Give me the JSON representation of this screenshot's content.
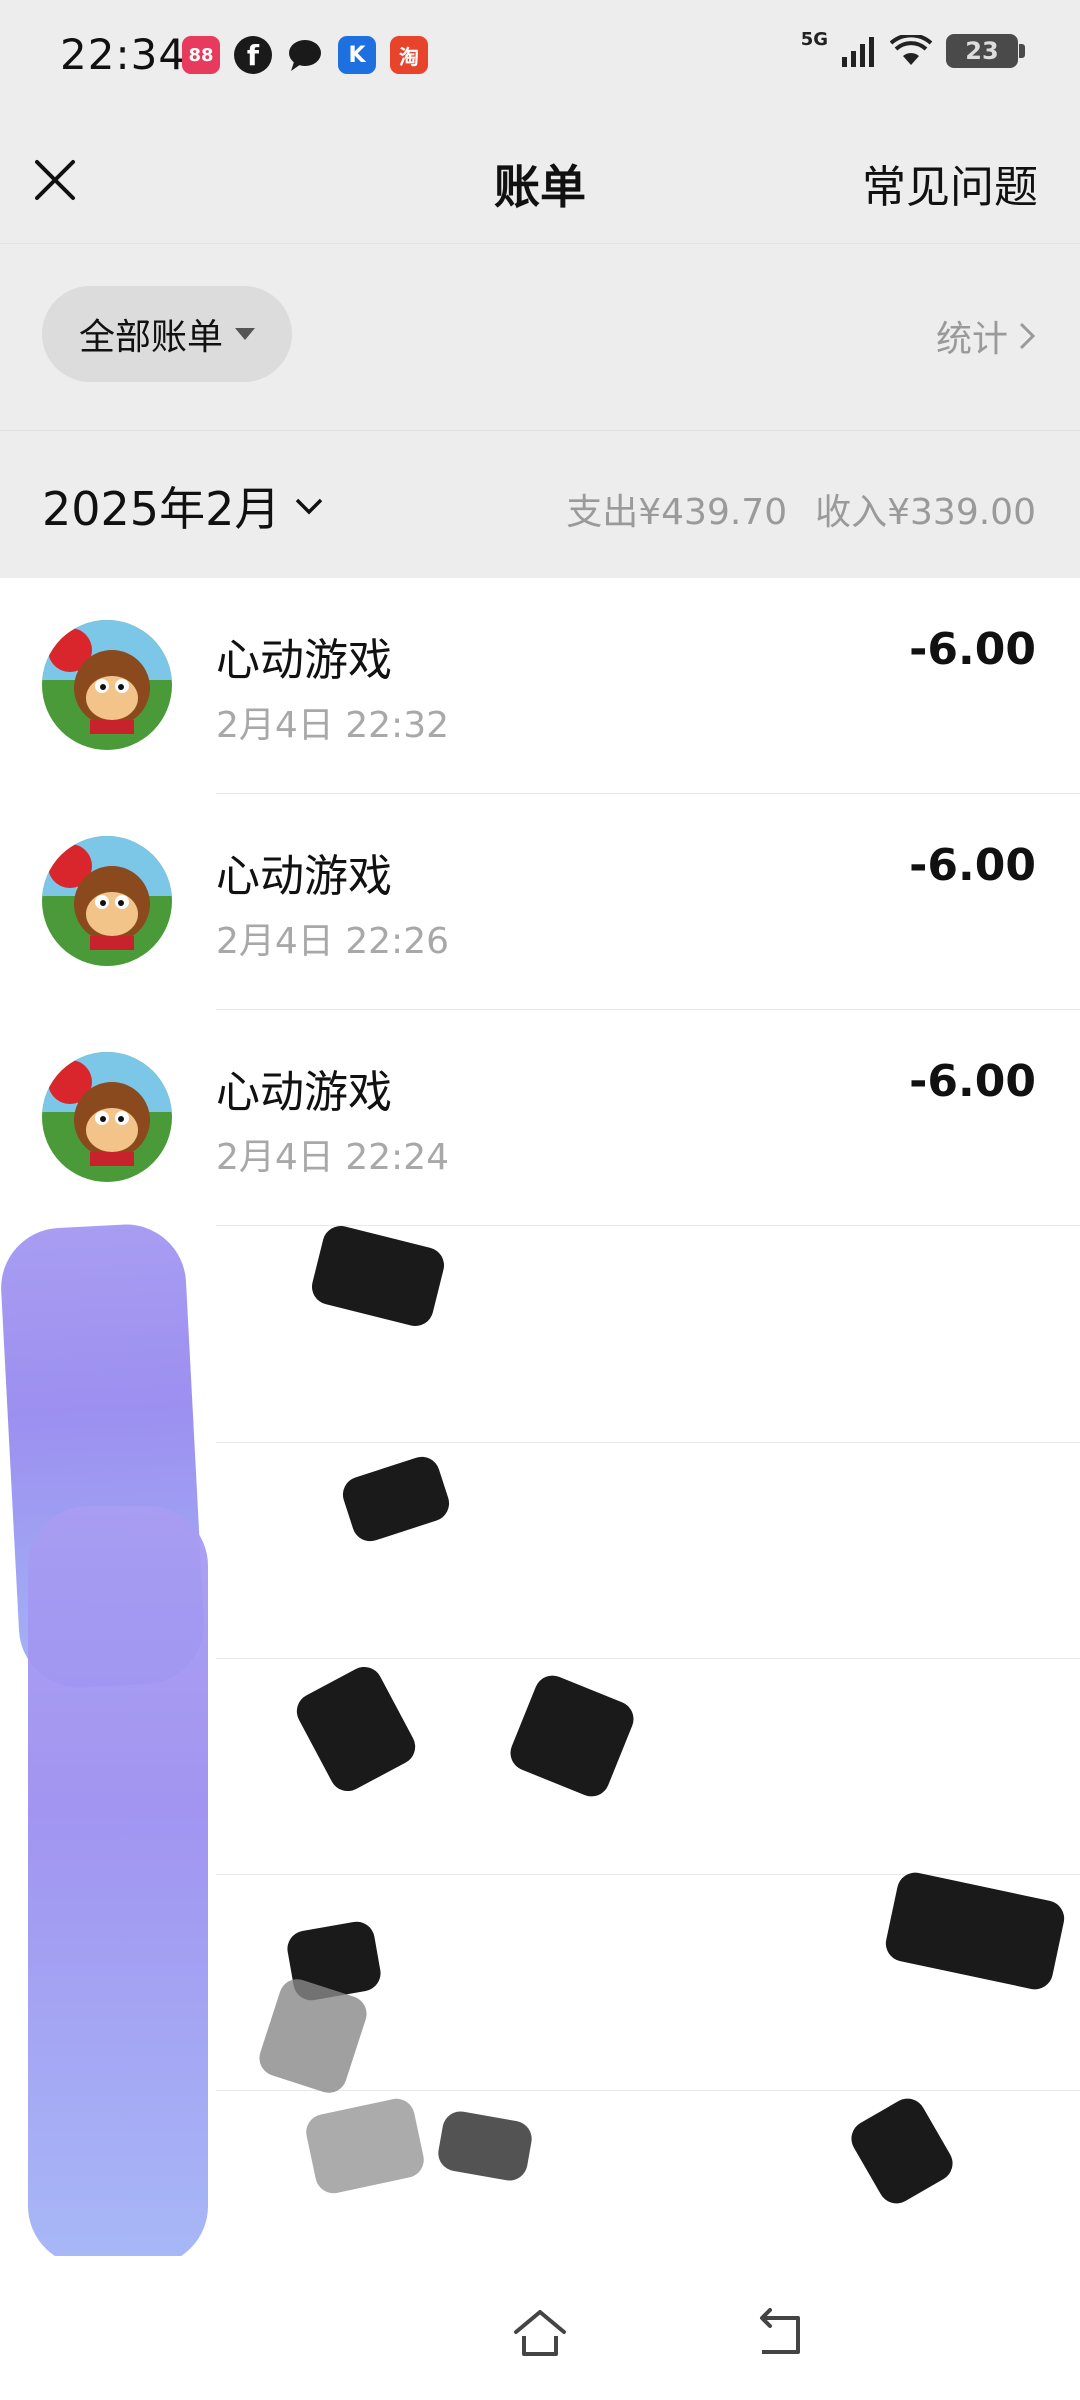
{
  "status_bar": {
    "time": "22:34",
    "network": "5G",
    "battery_level": "23",
    "apps": [
      {
        "icon": "app-red-icon",
        "color": "#e83a5c",
        "label": "88"
      },
      {
        "icon": "facebook-icon",
        "color": "#1a1a1a",
        "label": "f"
      },
      {
        "icon": "chat-bubble-icon",
        "color": "#1a1a1a",
        "label": ""
      },
      {
        "icon": "k-app-icon",
        "color": "#1e6fe0",
        "label": "K"
      },
      {
        "icon": "taobao-icon",
        "color": "#e8442b",
        "label": "淘"
      }
    ]
  },
  "header": {
    "title": "账单",
    "faq_label": "常见问题"
  },
  "filter": {
    "all_bills_label": "全部账单",
    "stats_label": "统计"
  },
  "month_bar": {
    "month_label": "2025年2月",
    "expense_label": "支出¥439.70",
    "income_label": "收入¥339.00"
  },
  "transactions": [
    {
      "name": "心动游戏",
      "time": "2月4日 22:32",
      "amount": "-6.00"
    },
    {
      "name": "心动游戏",
      "time": "2月4日 22:26",
      "amount": "-6.00"
    },
    {
      "name": "心动游戏",
      "time": "2月4日 22:24",
      "amount": "-6.00"
    }
  ],
  "colors": {
    "header_bg": "#ededed",
    "muted_text": "#9a9a9a",
    "pill_bg": "#dcdcdc",
    "redaction_purple": "#a89df2"
  }
}
